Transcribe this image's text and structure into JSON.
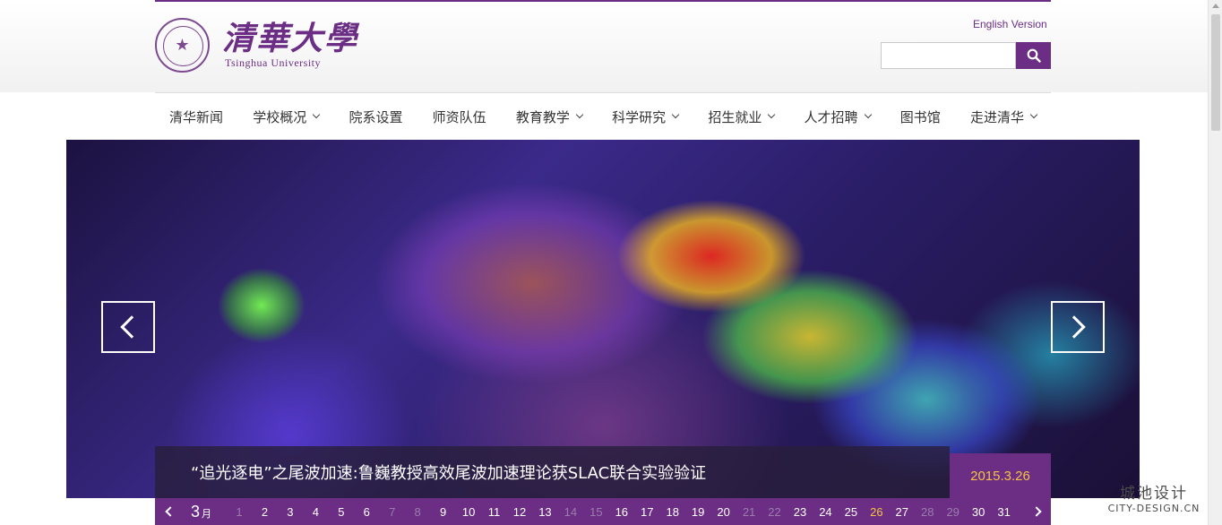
{
  "header": {
    "logo_cn": "清華大學",
    "logo_en": "Tsinghua University",
    "english_link": "English Version",
    "search_placeholder": ""
  },
  "nav": [
    {
      "label": "清华新闻",
      "dropdown": false
    },
    {
      "label": "学校概况",
      "dropdown": true
    },
    {
      "label": "院系设置",
      "dropdown": false
    },
    {
      "label": "师资队伍",
      "dropdown": false
    },
    {
      "label": "教育教学",
      "dropdown": true
    },
    {
      "label": "科学研究",
      "dropdown": true
    },
    {
      "label": "招生就业",
      "dropdown": true
    },
    {
      "label": "人才招聘",
      "dropdown": true
    },
    {
      "label": "图书馆",
      "dropdown": false
    },
    {
      "label": "走进清华",
      "dropdown": true
    }
  ],
  "slide": {
    "caption": "“追光逐电”之尾波加速:鲁巍教授高效尾波加速理论获SLAC联合实验验证",
    "date": "2015.3.26"
  },
  "calendar": {
    "month_num": "3",
    "month_unit": "月",
    "days": [
      {
        "d": "1",
        "state": "dim"
      },
      {
        "d": "2",
        "state": "normal"
      },
      {
        "d": "3",
        "state": "normal"
      },
      {
        "d": "4",
        "state": "normal"
      },
      {
        "d": "5",
        "state": "normal"
      },
      {
        "d": "6",
        "state": "normal"
      },
      {
        "d": "7",
        "state": "dim"
      },
      {
        "d": "8",
        "state": "dim"
      },
      {
        "d": "9",
        "state": "normal"
      },
      {
        "d": "10",
        "state": "normal"
      },
      {
        "d": "11",
        "state": "normal"
      },
      {
        "d": "12",
        "state": "normal"
      },
      {
        "d": "13",
        "state": "normal"
      },
      {
        "d": "14",
        "state": "dim"
      },
      {
        "d": "15",
        "state": "dim"
      },
      {
        "d": "16",
        "state": "normal"
      },
      {
        "d": "17",
        "state": "normal"
      },
      {
        "d": "18",
        "state": "normal"
      },
      {
        "d": "19",
        "state": "normal"
      },
      {
        "d": "20",
        "state": "normal"
      },
      {
        "d": "21",
        "state": "dim"
      },
      {
        "d": "22",
        "state": "dim"
      },
      {
        "d": "23",
        "state": "normal"
      },
      {
        "d": "24",
        "state": "normal"
      },
      {
        "d": "25",
        "state": "normal"
      },
      {
        "d": "26",
        "state": "active"
      },
      {
        "d": "27",
        "state": "normal"
      },
      {
        "d": "28",
        "state": "dim"
      },
      {
        "d": "29",
        "state": "dim"
      },
      {
        "d": "30",
        "state": "normal"
      },
      {
        "d": "31",
        "state": "normal"
      }
    ]
  },
  "watermark": {
    "cn": "城池设计",
    "en": "CITY-DESIGN.CN"
  },
  "colors": {
    "brand": "#6b2e84",
    "accent": "#f5c242"
  }
}
